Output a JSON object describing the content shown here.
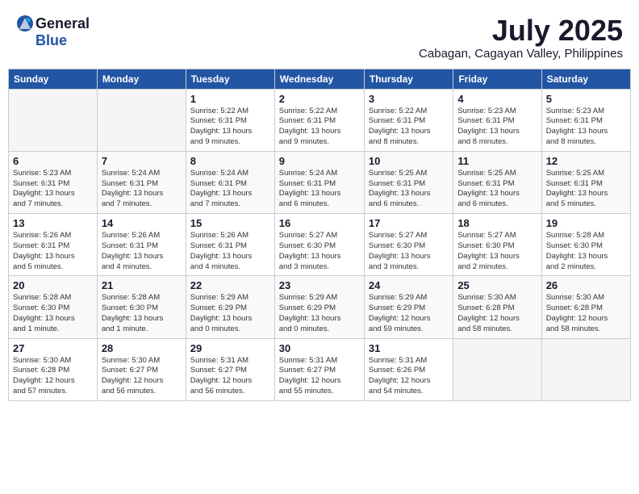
{
  "header": {
    "logo_general": "General",
    "logo_blue": "Blue",
    "title": "July 2025",
    "subtitle": "Cabagan, Cagayan Valley, Philippines"
  },
  "calendar": {
    "weekdays": [
      "Sunday",
      "Monday",
      "Tuesday",
      "Wednesday",
      "Thursday",
      "Friday",
      "Saturday"
    ],
    "weeks": [
      [
        {
          "day": "",
          "info": ""
        },
        {
          "day": "",
          "info": ""
        },
        {
          "day": "1",
          "info": "Sunrise: 5:22 AM\nSunset: 6:31 PM\nDaylight: 13 hours\nand 9 minutes."
        },
        {
          "day": "2",
          "info": "Sunrise: 5:22 AM\nSunset: 6:31 PM\nDaylight: 13 hours\nand 9 minutes."
        },
        {
          "day": "3",
          "info": "Sunrise: 5:22 AM\nSunset: 6:31 PM\nDaylight: 13 hours\nand 8 minutes."
        },
        {
          "day": "4",
          "info": "Sunrise: 5:23 AM\nSunset: 6:31 PM\nDaylight: 13 hours\nand 8 minutes."
        },
        {
          "day": "5",
          "info": "Sunrise: 5:23 AM\nSunset: 6:31 PM\nDaylight: 13 hours\nand 8 minutes."
        }
      ],
      [
        {
          "day": "6",
          "info": "Sunrise: 5:23 AM\nSunset: 6:31 PM\nDaylight: 13 hours\nand 7 minutes."
        },
        {
          "day": "7",
          "info": "Sunrise: 5:24 AM\nSunset: 6:31 PM\nDaylight: 13 hours\nand 7 minutes."
        },
        {
          "day": "8",
          "info": "Sunrise: 5:24 AM\nSunset: 6:31 PM\nDaylight: 13 hours\nand 7 minutes."
        },
        {
          "day": "9",
          "info": "Sunrise: 5:24 AM\nSunset: 6:31 PM\nDaylight: 13 hours\nand 6 minutes."
        },
        {
          "day": "10",
          "info": "Sunrise: 5:25 AM\nSunset: 6:31 PM\nDaylight: 13 hours\nand 6 minutes."
        },
        {
          "day": "11",
          "info": "Sunrise: 5:25 AM\nSunset: 6:31 PM\nDaylight: 13 hours\nand 6 minutes."
        },
        {
          "day": "12",
          "info": "Sunrise: 5:25 AM\nSunset: 6:31 PM\nDaylight: 13 hours\nand 5 minutes."
        }
      ],
      [
        {
          "day": "13",
          "info": "Sunrise: 5:26 AM\nSunset: 6:31 PM\nDaylight: 13 hours\nand 5 minutes."
        },
        {
          "day": "14",
          "info": "Sunrise: 5:26 AM\nSunset: 6:31 PM\nDaylight: 13 hours\nand 4 minutes."
        },
        {
          "day": "15",
          "info": "Sunrise: 5:26 AM\nSunset: 6:31 PM\nDaylight: 13 hours\nand 4 minutes."
        },
        {
          "day": "16",
          "info": "Sunrise: 5:27 AM\nSunset: 6:30 PM\nDaylight: 13 hours\nand 3 minutes."
        },
        {
          "day": "17",
          "info": "Sunrise: 5:27 AM\nSunset: 6:30 PM\nDaylight: 13 hours\nand 3 minutes."
        },
        {
          "day": "18",
          "info": "Sunrise: 5:27 AM\nSunset: 6:30 PM\nDaylight: 13 hours\nand 2 minutes."
        },
        {
          "day": "19",
          "info": "Sunrise: 5:28 AM\nSunset: 6:30 PM\nDaylight: 13 hours\nand 2 minutes."
        }
      ],
      [
        {
          "day": "20",
          "info": "Sunrise: 5:28 AM\nSunset: 6:30 PM\nDaylight: 13 hours\nand 1 minute."
        },
        {
          "day": "21",
          "info": "Sunrise: 5:28 AM\nSunset: 6:30 PM\nDaylight: 13 hours\nand 1 minute."
        },
        {
          "day": "22",
          "info": "Sunrise: 5:29 AM\nSunset: 6:29 PM\nDaylight: 13 hours\nand 0 minutes."
        },
        {
          "day": "23",
          "info": "Sunrise: 5:29 AM\nSunset: 6:29 PM\nDaylight: 13 hours\nand 0 minutes."
        },
        {
          "day": "24",
          "info": "Sunrise: 5:29 AM\nSunset: 6:29 PM\nDaylight: 12 hours\nand 59 minutes."
        },
        {
          "day": "25",
          "info": "Sunrise: 5:30 AM\nSunset: 6:28 PM\nDaylight: 12 hours\nand 58 minutes."
        },
        {
          "day": "26",
          "info": "Sunrise: 5:30 AM\nSunset: 6:28 PM\nDaylight: 12 hours\nand 58 minutes."
        }
      ],
      [
        {
          "day": "27",
          "info": "Sunrise: 5:30 AM\nSunset: 6:28 PM\nDaylight: 12 hours\nand 57 minutes."
        },
        {
          "day": "28",
          "info": "Sunrise: 5:30 AM\nSunset: 6:27 PM\nDaylight: 12 hours\nand 56 minutes."
        },
        {
          "day": "29",
          "info": "Sunrise: 5:31 AM\nSunset: 6:27 PM\nDaylight: 12 hours\nand 56 minutes."
        },
        {
          "day": "30",
          "info": "Sunrise: 5:31 AM\nSunset: 6:27 PM\nDaylight: 12 hours\nand 55 minutes."
        },
        {
          "day": "31",
          "info": "Sunrise: 5:31 AM\nSunset: 6:26 PM\nDaylight: 12 hours\nand 54 minutes."
        },
        {
          "day": "",
          "info": ""
        },
        {
          "day": "",
          "info": ""
        }
      ]
    ]
  }
}
